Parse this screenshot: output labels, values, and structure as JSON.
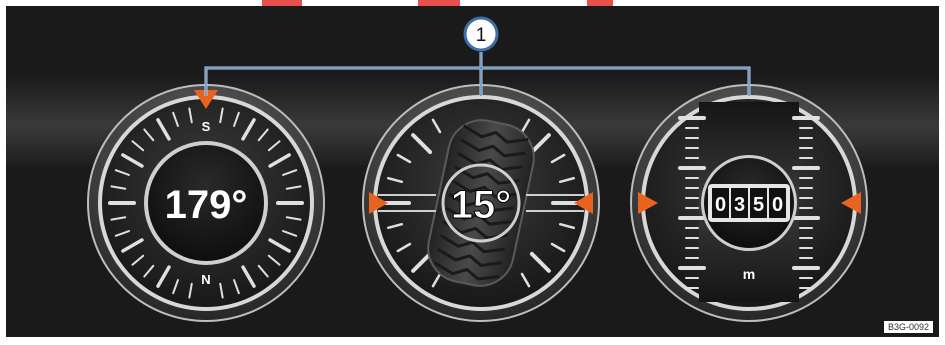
{
  "callout": {
    "number": "1"
  },
  "compass": {
    "heading_label": "179°",
    "north_letter": "N",
    "south_letter": "S"
  },
  "inclinometer": {
    "angle_label": "15°"
  },
  "altimeter": {
    "digits": [
      "0",
      "3",
      "5",
      "0"
    ],
    "unit": "m"
  },
  "image_code": "B3G-0092",
  "colors": {
    "accent_orange": "#e8641e",
    "callout_line": "#b9d4ee",
    "background": "#1a1a1a"
  }
}
